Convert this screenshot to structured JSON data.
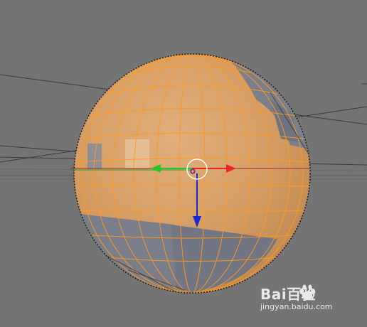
{
  "colors": {
    "background": "#747474",
    "selected_face": "#d7a06a",
    "selected_edge": "#ff9a1f",
    "unselected_face": "#7a7d88",
    "unselected_edge": "#1a1a1a",
    "axis_x": "#e8262a",
    "axis_y": "#26c626",
    "axis_z": "#1a28d6",
    "cursor": "#ffffff"
  },
  "icons": {
    "mesh": "uv-sphere",
    "gizmo": "translate-manipulator-icon",
    "cursor": "3d-cursor-icon",
    "watermark": "baidu-paw-logo"
  },
  "watermark": {
    "logo": "Bai百验",
    "url": "jingyan.baidu.com"
  }
}
